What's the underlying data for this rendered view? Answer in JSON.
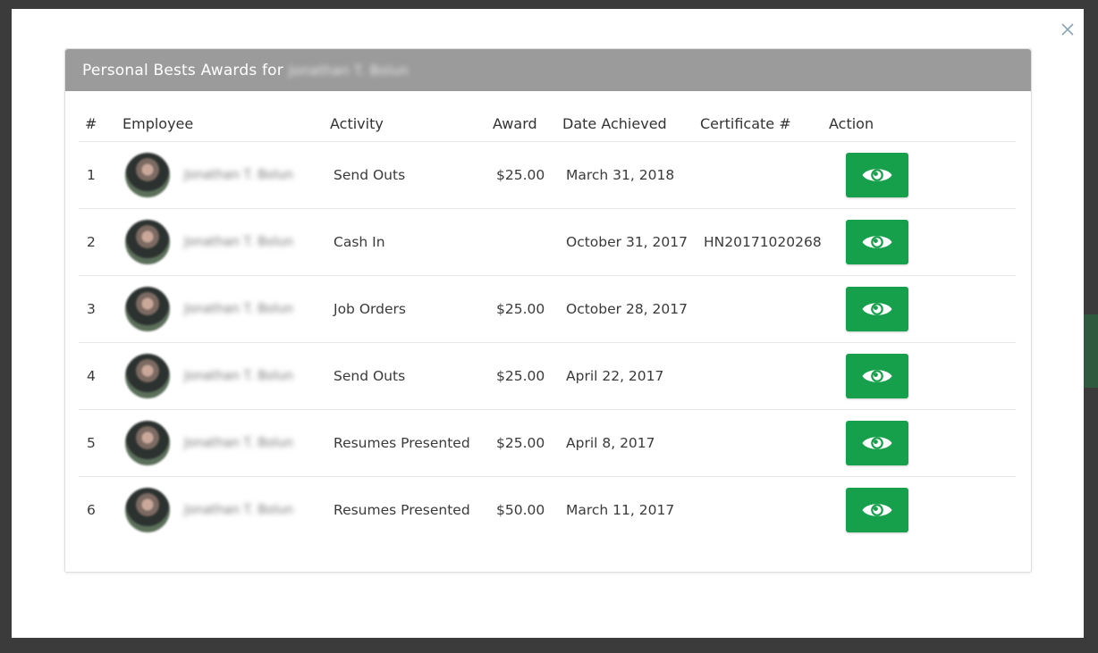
{
  "modal": {
    "title": "Personal Bests Awards for",
    "title_name": "Jonathan T. Bolun",
    "close_icon": "close-icon"
  },
  "table": {
    "headers": {
      "num": "#",
      "employee": "Employee",
      "activity": "Activity",
      "award": "Award",
      "date": "Date Achieved",
      "certificate": "Certificate #",
      "action": "Action"
    },
    "rows": [
      {
        "num": "1",
        "employee": "Jonathan T. Bolun",
        "activity": "Send Outs",
        "award": "$25.00",
        "date": "March 31, 2018",
        "certificate": ""
      },
      {
        "num": "2",
        "employee": "Jonathan T. Bolun",
        "activity": "Cash In",
        "award": "",
        "date": "October 31, 2017",
        "certificate": "HN20171020268"
      },
      {
        "num": "3",
        "employee": "Jonathan T. Bolun",
        "activity": "Job Orders",
        "award": "$25.00",
        "date": "October 28, 2017",
        "certificate": ""
      },
      {
        "num": "4",
        "employee": "Jonathan T. Bolun",
        "activity": "Send Outs",
        "award": "$25.00",
        "date": "April 22, 2017",
        "certificate": ""
      },
      {
        "num": "5",
        "employee": "Jonathan T. Bolun",
        "activity": "Resumes Presented",
        "award": "$25.00",
        "date": "April 8, 2017",
        "certificate": ""
      },
      {
        "num": "6",
        "employee": "Jonathan T. Bolun",
        "activity": "Resumes Presented",
        "award": "$50.00",
        "date": "March 11, 2017",
        "certificate": ""
      }
    ]
  },
  "colors": {
    "header_bg": "#9b9b9b",
    "action_button": "#16a04b",
    "overlay": "#3a3a3a"
  },
  "icons": {
    "action": "eye-icon"
  }
}
